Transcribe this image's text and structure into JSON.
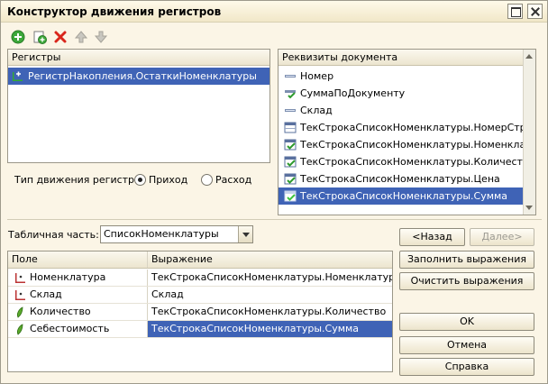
{
  "window": {
    "title": "Конструктор движения регистров"
  },
  "toolbar": {
    "icons": [
      "add-icon",
      "add-copy-icon",
      "delete-icon",
      "move-up-icon",
      "move-down-icon"
    ]
  },
  "registers_panel": {
    "header": "Регистры",
    "items": [
      {
        "label": "РегистрНакопления.ОстаткиНоменклатуры",
        "selected": true,
        "icon": "accumulation-register-icon"
      }
    ]
  },
  "movement_type": {
    "label": "Тип движения регистра:",
    "options": [
      {
        "label": "Приход",
        "checked": true
      },
      {
        "label": "Расход",
        "checked": false
      }
    ]
  },
  "requisites_panel": {
    "header": "Реквизиты документа",
    "items": [
      {
        "label": "Номер",
        "icon": "attribute-icon",
        "selected": false
      },
      {
        "label": "СуммаПоДокументу",
        "icon": "attribute-check-icon",
        "selected": false
      },
      {
        "label": "Склад",
        "icon": "attribute-icon",
        "selected": false
      },
      {
        "label": "ТекСтрокаСписокНоменклатуры.НомерСтроки",
        "icon": "table-attribute-icon",
        "selected": false
      },
      {
        "label": "ТекСтрокаСписокНоменклатуры.Номенклату...",
        "icon": "table-attribute-check-icon",
        "selected": false
      },
      {
        "label": "ТекСтрокаСписокНоменклатуры.Количество",
        "icon": "table-attribute-check-icon",
        "selected": false
      },
      {
        "label": "ТекСтрокаСписокНоменклатуры.Цена",
        "icon": "table-attribute-check-icon",
        "selected": false
      },
      {
        "label": "ТекСтрокаСписокНоменклатуры.Сумма",
        "icon": "table-attribute-check-icon",
        "selected": true
      }
    ]
  },
  "tabular_part": {
    "label": "Табличная часть:",
    "value": "СписокНоменклатуры"
  },
  "nav_buttons": {
    "back": "<Назад",
    "next": "Далее>"
  },
  "grid": {
    "columns": [
      "Поле",
      "Выражение"
    ],
    "rows": [
      {
        "field": "Номенклатура",
        "expression": "ТекСтрокаСписокНоменклатуры.Номенклатура",
        "icon": "dimension-icon",
        "selected": false
      },
      {
        "field": "Склад",
        "expression": "Склад",
        "icon": "dimension-icon",
        "selected": false
      },
      {
        "field": "Количество",
        "expression": "ТекСтрокаСписокНоменклатуры.Количество",
        "icon": "resource-icon",
        "selected": false
      },
      {
        "field": "Себестоимость",
        "expression": "ТекСтрокаСписокНоменклатуры.Сумма",
        "icon": "resource-icon",
        "selected": true
      }
    ]
  },
  "action_buttons": {
    "fill": "Заполнить выражения",
    "clear": "Очистить выражения",
    "ok": "OK",
    "cancel": "Отмена",
    "help": "Справка"
  }
}
